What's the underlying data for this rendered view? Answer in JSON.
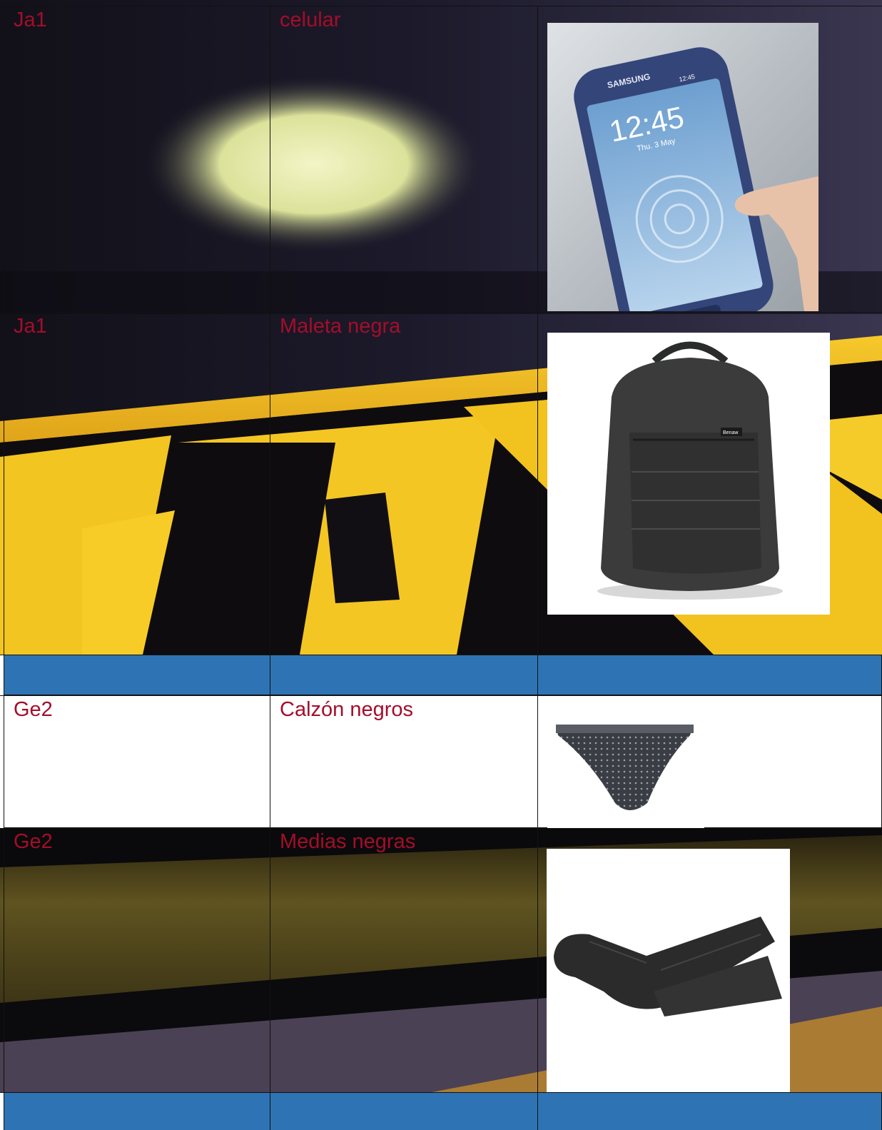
{
  "colors": {
    "label_text": "#a40d2a",
    "header_blue": "#2e74b5",
    "grid_line": "#111111"
  },
  "rows": [
    {
      "code": "Ja1",
      "item": "celular",
      "image": "smartphone-image"
    },
    {
      "code": "Ja1",
      "item": "Maleta negra",
      "image": "backpack-image"
    },
    {
      "code": "Ge2",
      "item": "Calzón negros",
      "image": "underwear-image"
    },
    {
      "code": "Ge2",
      "item": "Medias negras",
      "image": "socks-image"
    }
  ],
  "phone": {
    "brand": "SAMSUNG",
    "time": "12:45",
    "date": "Thu. 3 May",
    "status_time": "12:45"
  },
  "backpack": {
    "brand": "Benaw"
  }
}
